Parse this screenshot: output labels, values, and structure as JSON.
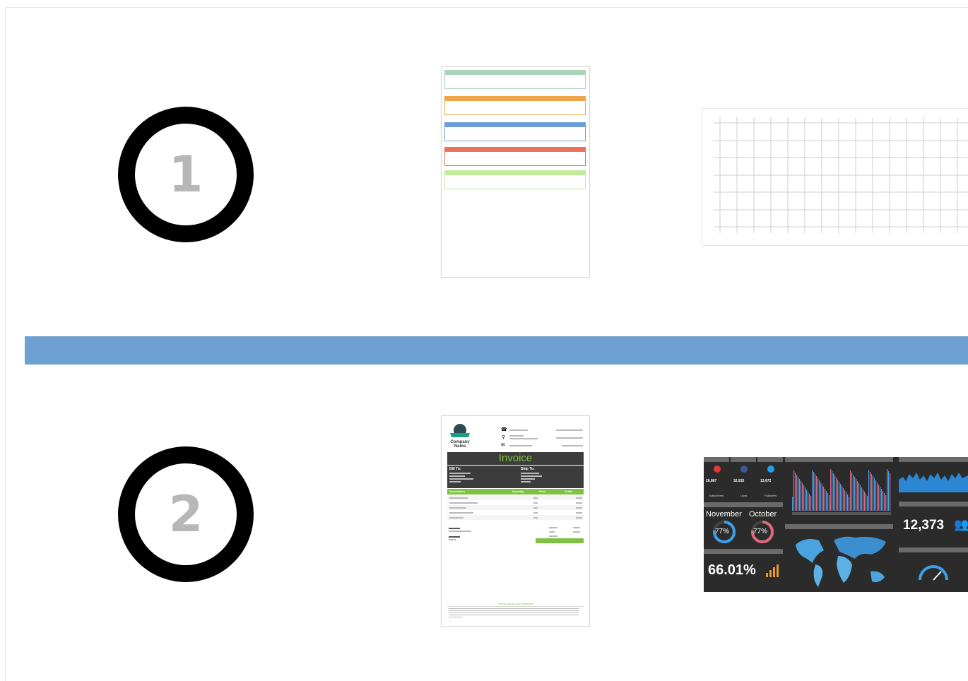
{
  "steps": [
    {
      "number": "1"
    },
    {
      "number": "2"
    }
  ],
  "invoice": {
    "company_line1": "Company",
    "company_line2": "Name",
    "title": "Invoice",
    "bill_to": "Bill To:",
    "ship_to": "Ship To:",
    "col_description": "Description",
    "col_quantity": "Quantity",
    "col_price": "Price",
    "col_totals": "Totals",
    "footer_thanks": "Thank you for your business"
  },
  "dashboard": {
    "youtube_count": "26,867",
    "facebook_count": "32,815",
    "twitter_count": "13,672",
    "subscribers_label": "Subscribers",
    "likes_label": "Likes",
    "followers_label": "Followers",
    "month_1": "November",
    "month_2": "October",
    "pct_1": "77%",
    "pct_2": "77%",
    "bounce_rate": "66.01%",
    "visitors": "12,373"
  },
  "colors": {
    "divider": "#6fa0d2",
    "box_green": "#a8d5b7",
    "box_orange": "#efa54a",
    "box_blue": "#6d9fd6",
    "box_red": "#e8735a",
    "box_lime": "#c4ea9d",
    "invoice_green": "#7dc242",
    "dash_bg": "#2b2b2b",
    "dash_blue": "#3aa0e8",
    "dash_pink": "#d76a8a"
  }
}
